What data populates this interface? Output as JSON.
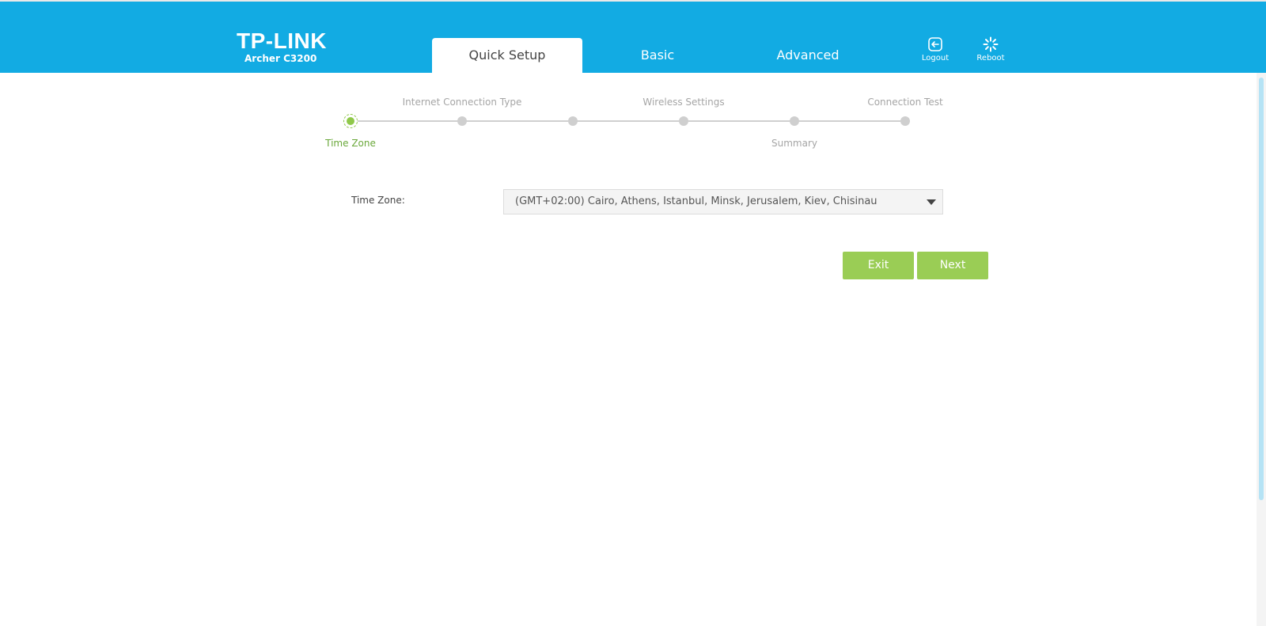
{
  "header": {
    "brand": "TP-LINK",
    "model": "Archer C3200",
    "tabs": [
      {
        "label": "Quick Setup",
        "active": true
      },
      {
        "label": "Basic",
        "active": false
      },
      {
        "label": "Advanced",
        "active": false
      }
    ],
    "logout_label": "Logout",
    "reboot_label": "Reboot"
  },
  "wizard": {
    "steps": [
      {
        "label": "Time Zone",
        "active": true
      },
      {
        "label": "Internet Connection Type",
        "active": false
      },
      {
        "label": "",
        "active": false
      },
      {
        "label": "Wireless Settings",
        "active": false
      },
      {
        "label": "Summary",
        "active": false
      },
      {
        "label": "Connection Test",
        "active": false
      }
    ]
  },
  "form": {
    "timezone_label": "Time Zone:",
    "timezone_value": "(GMT+02:00) Cairo, Athens, Istanbul, Minsk, Jerusalem, Kiev, Chisinau"
  },
  "buttons": {
    "exit": "Exit",
    "next": "Next"
  },
  "colors": {
    "header_bg": "#12abe3",
    "accent_green": "#9acd55",
    "active_step": "#6aa83a"
  }
}
